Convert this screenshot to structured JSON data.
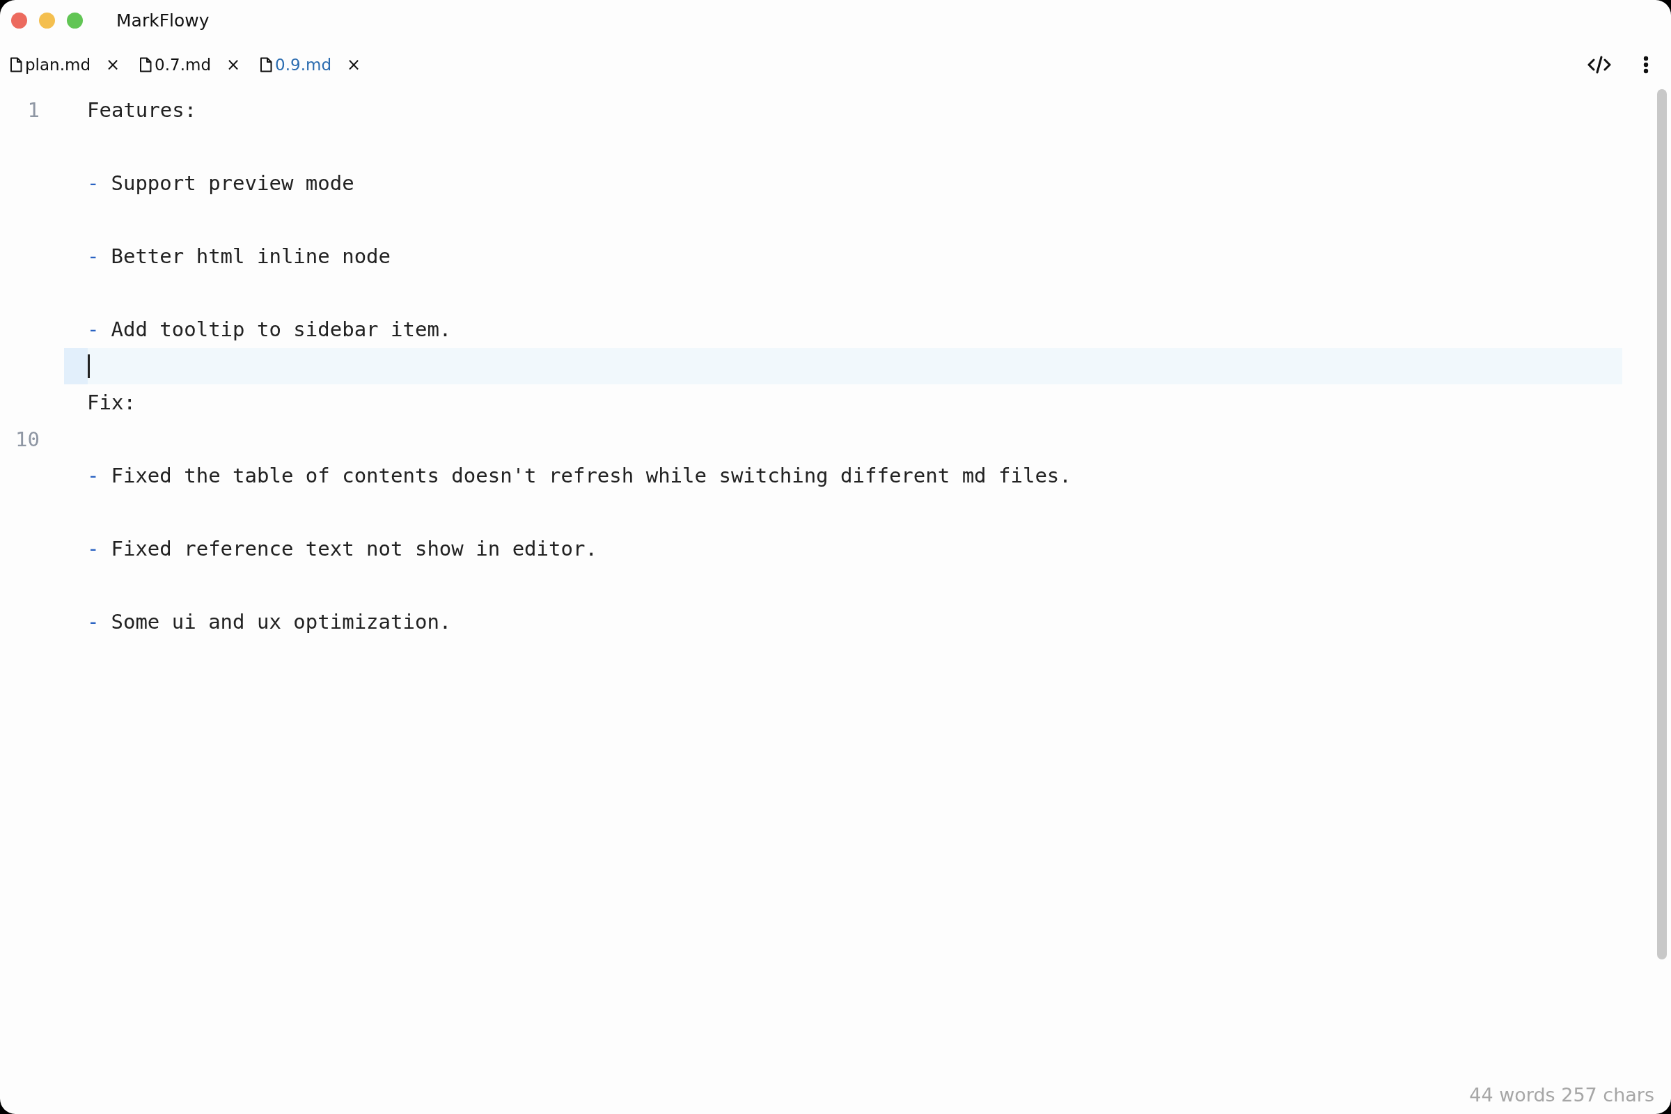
{
  "window": {
    "title": "MarkFlowy"
  },
  "tabs": [
    {
      "label": "plan.md",
      "close": "×",
      "selected": false
    },
    {
      "label": "0.7.md",
      "close": "×",
      "selected": false
    },
    {
      "label": "0.9.md",
      "close": "×",
      "selected": true
    }
  ],
  "editor": {
    "lines": [
      {
        "number": "1",
        "kind": "text",
        "text": "Features:",
        "current": false
      },
      {
        "kind": "blank",
        "current": false
      },
      {
        "kind": "bullet",
        "marker": "-",
        "text": "Support preview mode",
        "current": false
      },
      {
        "kind": "blank",
        "current": false
      },
      {
        "kind": "bullet",
        "marker": "-",
        "text": "Better html inline node",
        "current": false
      },
      {
        "kind": "blank",
        "current": false
      },
      {
        "kind": "bullet",
        "marker": "-",
        "text": "Add tooltip to sidebar item.",
        "current": false
      },
      {
        "kind": "blank",
        "current": true
      },
      {
        "kind": "text",
        "text": "Fix:",
        "current": false
      },
      {
        "number": "10",
        "kind": "blank",
        "current": false
      },
      {
        "kind": "bullet",
        "marker": "-",
        "text": "Fixed the table of contents doesn't refresh while switching different md files.",
        "current": false
      },
      {
        "kind": "blank",
        "current": false
      },
      {
        "kind": "bullet",
        "marker": "-",
        "text": "Fixed reference text not show in editor.",
        "current": false
      },
      {
        "kind": "blank",
        "current": false
      },
      {
        "kind": "bullet",
        "marker": "-",
        "text": "Some ui and ux optimization.",
        "current": false
      }
    ]
  },
  "status_bar": {
    "counts": "44 words 257 chars"
  }
}
